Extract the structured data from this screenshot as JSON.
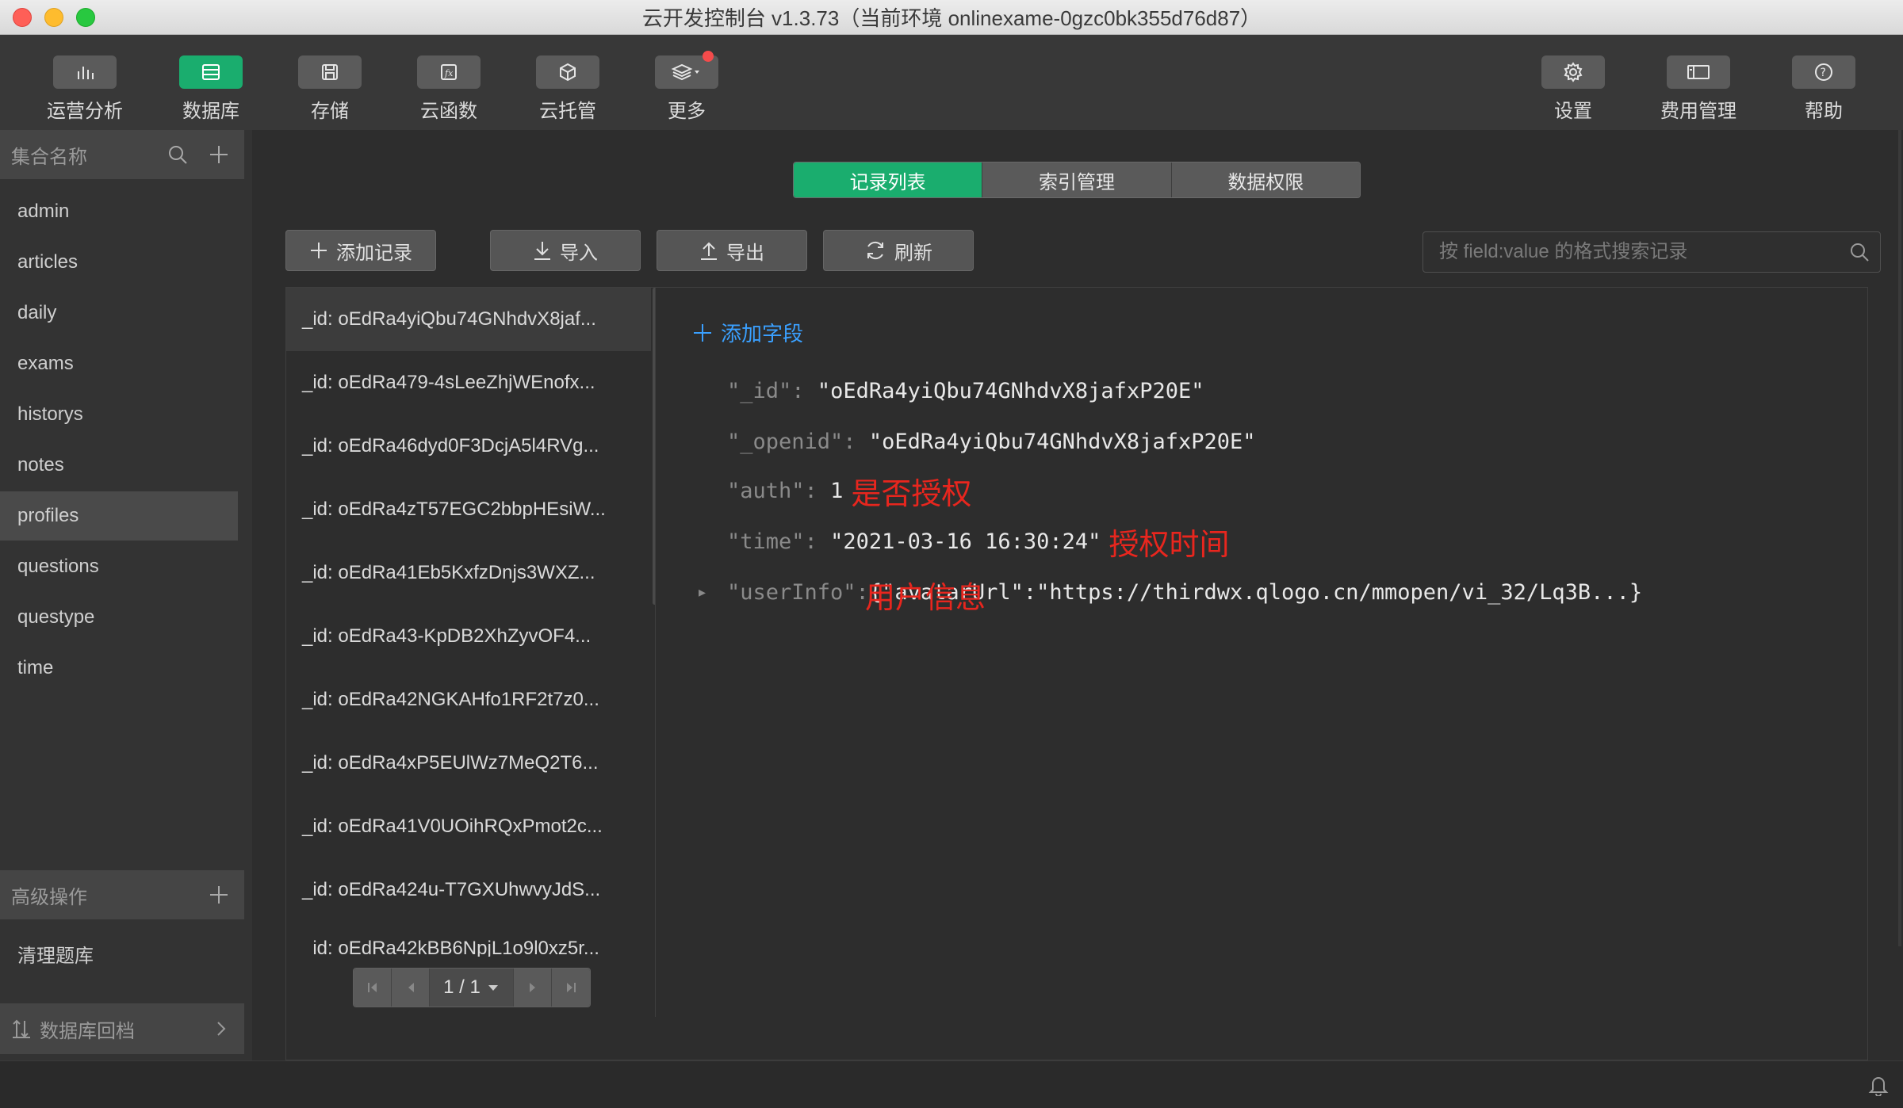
{
  "window": {
    "title": "云开发控制台 v1.3.73（当前环境 onlinexame-0gzc0bk355d76d87）"
  },
  "toolbar": {
    "left": [
      {
        "label": "运营分析",
        "icon": "bar-chart-icon",
        "active": false
      },
      {
        "label": "数据库",
        "icon": "database-icon",
        "active": true
      },
      {
        "label": "存储",
        "icon": "storage-icon",
        "active": false
      },
      {
        "label": "云函数",
        "icon": "function-icon",
        "active": false
      },
      {
        "label": "云托管",
        "icon": "cube-icon",
        "active": false
      },
      {
        "label": "更多",
        "icon": "layers-icon",
        "active": false
      }
    ],
    "right": [
      {
        "label": "设置",
        "icon": "gear-icon"
      },
      {
        "label": "费用管理",
        "icon": "billing-icon"
      },
      {
        "label": "帮助",
        "icon": "help-icon"
      }
    ]
  },
  "sidebar": {
    "header": "集合名称",
    "collections": [
      "admin",
      "articles",
      "daily",
      "exams",
      "historys",
      "notes",
      "profiles",
      "questions",
      "questype",
      "time"
    ],
    "selected": "profiles",
    "advanced_header": "高级操作",
    "advanced_items": [
      "清理题库"
    ],
    "footer": "数据库回档"
  },
  "tabs": {
    "items": [
      "记录列表",
      "索引管理",
      "数据权限"
    ],
    "active": "记录列表"
  },
  "actions": {
    "add": "添加记录",
    "import": "导入",
    "export": "导出",
    "refresh": "刷新"
  },
  "search": {
    "placeholder": "按 field:value 的格式搜索记录"
  },
  "records": [
    "_id: oEdRa4yiQbu74GNhdvX8jaf...",
    "_id: oEdRa479-4sLeeZhjWEnofx...",
    "_id: oEdRa46dyd0F3DcjA5l4RVg...",
    "_id: oEdRa4zT57EGC2bbpHEsiW...",
    "_id: oEdRa41Eb5KxfzDnjs3WXZ...",
    "_id: oEdRa43-KpDB2XhZyvOF4...",
    "_id: oEdRa42NGKAHfo1RF2t7z0...",
    "_id: oEdRa4xP5EUlWz7MeQ2T6...",
    "_id: oEdRa41V0UOihRQxPmot2c...",
    "_id: oEdRa424u-T7GXUhwvyJdS...",
    "_id: oEdRa42kBB6NpjL1o9l0xz5r..."
  ],
  "pager": {
    "current": "1 / 1"
  },
  "detail": {
    "add_field": "添加字段",
    "fields": [
      {
        "key": "\"_id\":",
        "value": "\"oEdRa4yiQbu74GNhdvX8jafxP20E\"",
        "note": ""
      },
      {
        "key": "\"_openid\":",
        "value": "\"oEdRa4yiQbu74GNhdvX8jafxP20E\"",
        "note": ""
      },
      {
        "key": "\"auth\":",
        "value": "1",
        "note": "是否授权"
      },
      {
        "key": "\"time\":",
        "value": "\"2021-03-16 16:30:24\"",
        "note": "授权时间"
      },
      {
        "key": "\"userInfo\":",
        "value": "{\"avatarUrl\":\"https://thirdwx.qlogo.cn/mmopen/vi_32/Lq3B...}",
        "note": "用户信息"
      }
    ]
  },
  "colors": {
    "accent_green": "#1aad6e",
    "annotation_red": "#e8261e",
    "link_blue": "#3aa0ff"
  }
}
